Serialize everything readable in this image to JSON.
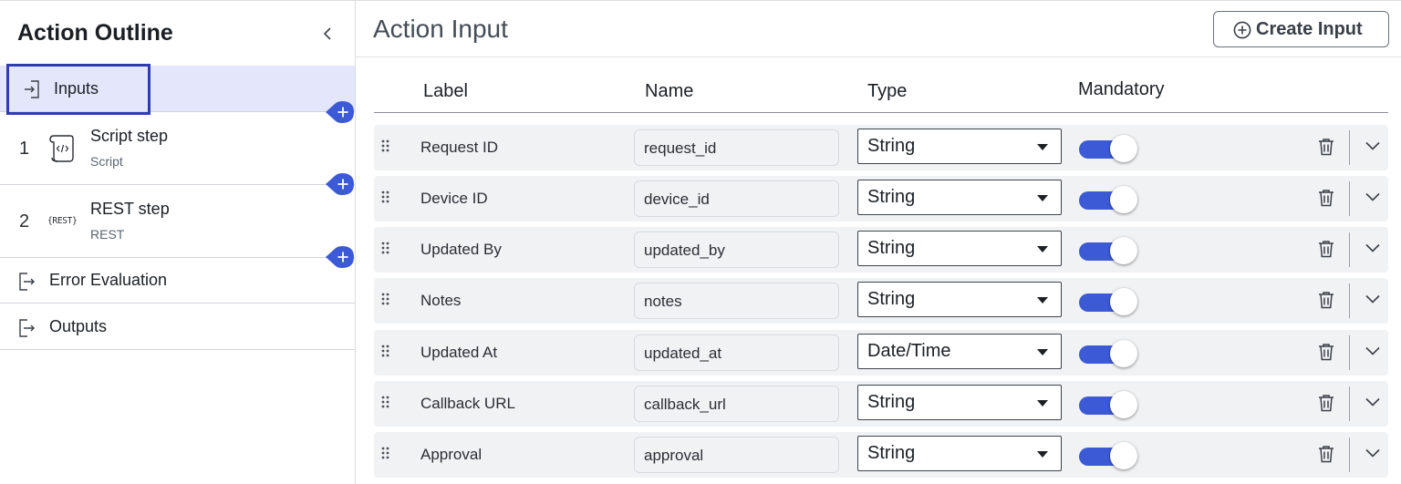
{
  "sidebar": {
    "title": "Action Outline",
    "inputs_label": "Inputs",
    "steps": [
      {
        "number": "1",
        "name": "Script step",
        "type": "Script",
        "icon": "script-icon"
      },
      {
        "number": "2",
        "name": "REST step",
        "type": "REST",
        "icon": "rest-icon",
        "icon_text": "{REST}"
      }
    ],
    "error_evaluation_label": "Error Evaluation",
    "outputs_label": "Outputs"
  },
  "main": {
    "title": "Action Input",
    "create_button_label": "Create Input",
    "columns": {
      "label": "Label",
      "name": "Name",
      "type": "Type",
      "mandatory": "Mandatory"
    },
    "rows": [
      {
        "label": "Request ID",
        "name": "request_id",
        "type": "String",
        "mandatory": true
      },
      {
        "label": "Device ID",
        "name": "device_id",
        "type": "String",
        "mandatory": true
      },
      {
        "label": "Updated By",
        "name": "updated_by",
        "type": "String",
        "mandatory": true
      },
      {
        "label": "Notes",
        "name": "notes",
        "type": "String",
        "mandatory": true
      },
      {
        "label": "Updated At",
        "name": "updated_at",
        "type": "Date/Time",
        "mandatory": true
      },
      {
        "label": "Callback URL",
        "name": "callback_url",
        "type": "String",
        "mandatory": true
      },
      {
        "label": "Approval",
        "name": "approval",
        "type": "String",
        "mandatory": true
      }
    ]
  },
  "colors": {
    "accent": "#3d5ad6",
    "selected_bg": "#e4e7fb",
    "focus_outline": "#2f3bb5",
    "row_bg": "#f1f2f4"
  }
}
